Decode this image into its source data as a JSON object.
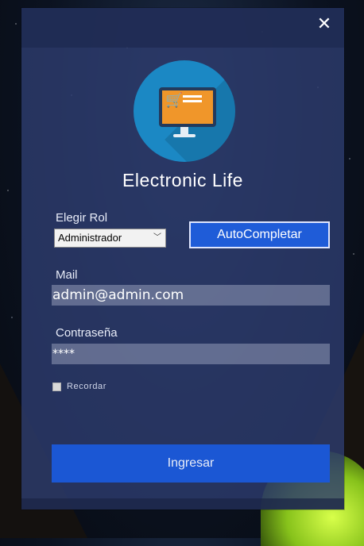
{
  "app": {
    "title": "Electronic Life",
    "close_icon": "close-icon",
    "logo_icon": "shopping-cart-monitor-icon"
  },
  "colors": {
    "dialog_bg": "#2d3c6e",
    "primary_button": "#1b57d4",
    "autocomplete_button": "#1f5cd8",
    "logo_circle": "#1b88c4",
    "monitor": "#f0962a"
  },
  "form": {
    "role_label": "Elegir Rol",
    "role_selected": "Administrador",
    "autocomplete_label": "AutoCompletar",
    "mail_label": "Mail",
    "mail_value": "admin@admin.com",
    "password_label": "Contraseña",
    "password_value": "****",
    "remember_label": "Recordar",
    "remember_checked": false,
    "submit_label": "Ingresar"
  }
}
